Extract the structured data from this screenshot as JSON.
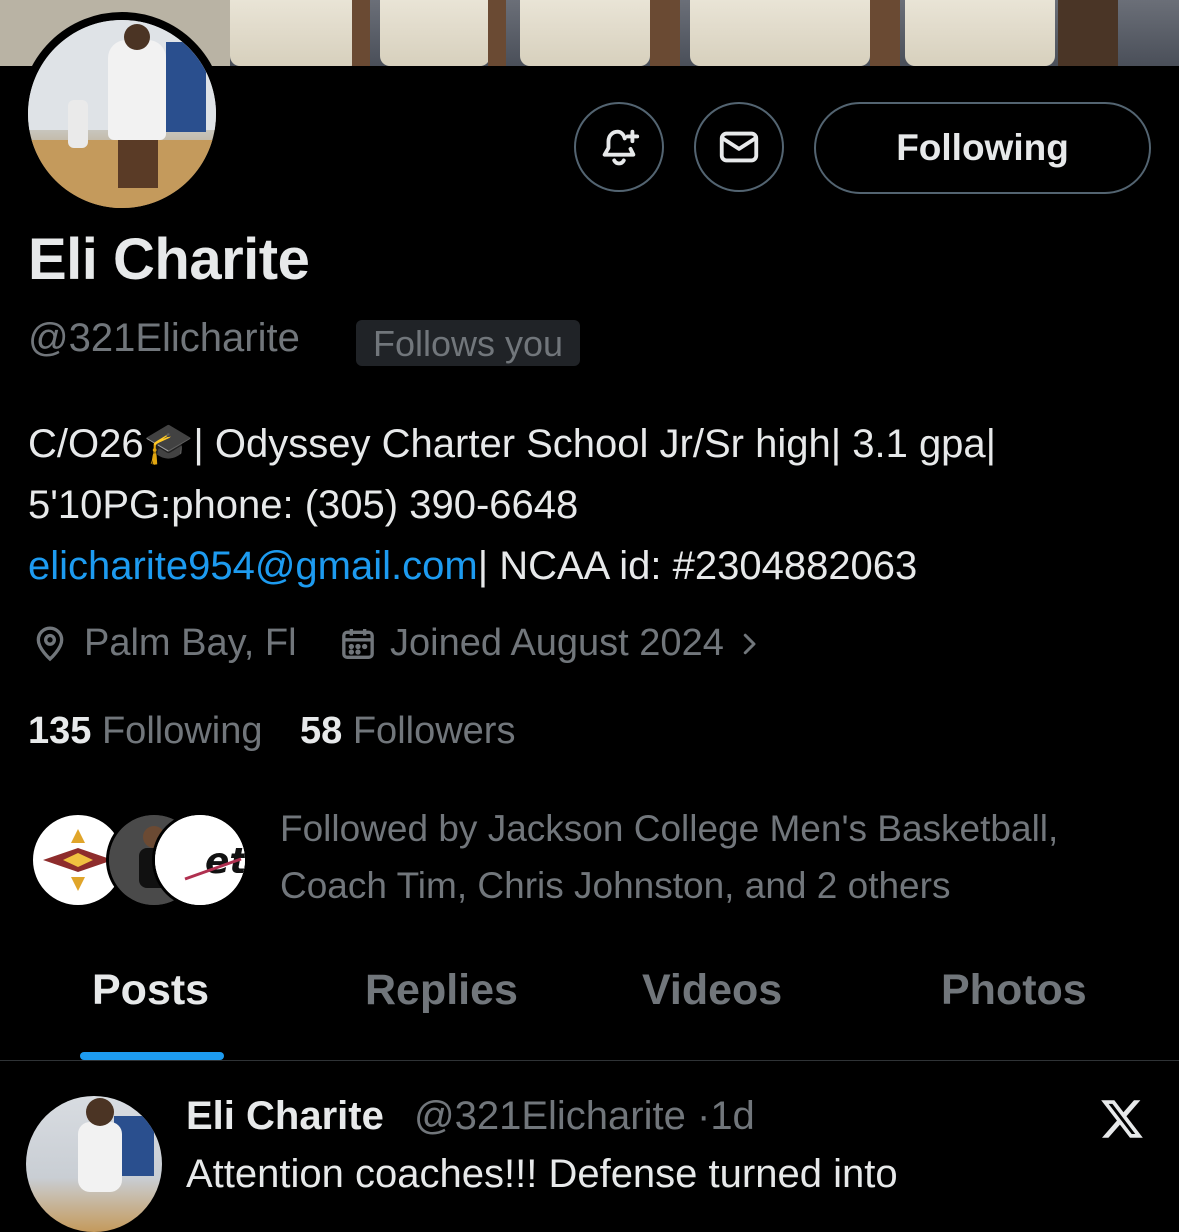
{
  "profile": {
    "name": "Eli Charite",
    "handle": "@321Elicharite",
    "follows_you": "Follows you",
    "bio_line1": "C/O26🎓| Odyssey Charter School Jr/Sr high| 3.1 gpa|",
    "bio_line2": "5'10PG:phone: (305) 390-6648",
    "bio_email": "elicharite954@gmail.com",
    "bio_line3_rest": "| NCAA id: #2304882063",
    "location": "Palm Bay, Fl",
    "joined": "Joined August 2024",
    "following_count": "135",
    "following_label": "Following",
    "followers_count": "58",
    "followers_label": "Followers",
    "followed_by_line1": "Followed by Jackson College Men's Basketball,",
    "followed_by_line2": "Coach Tim, Chris Johnston, and 2 others"
  },
  "actions": {
    "following_button": "Following"
  },
  "tabs": [
    {
      "label": "Posts",
      "active": true
    },
    {
      "label": "Replies",
      "active": false
    },
    {
      "label": "Videos",
      "active": false
    },
    {
      "label": "Photos",
      "active": false
    }
  ],
  "post": {
    "author": "Eli Charite",
    "handle": "@321Elicharite",
    "separator": "·",
    "time": "1d",
    "text_preview": "Attention coaches!!! Defense turned into"
  },
  "icons": {
    "notify": "bell-plus-icon",
    "message": "envelope-icon",
    "location": "location-pin-icon",
    "calendar": "calendar-icon",
    "chevron": "chevron-right-icon",
    "logo": "x-logo-icon"
  },
  "colors": {
    "background": "#000000",
    "primary_text": "#e7e9ea",
    "secondary_text": "#71767b",
    "accent": "#1d9bf0",
    "border": "#536471"
  }
}
